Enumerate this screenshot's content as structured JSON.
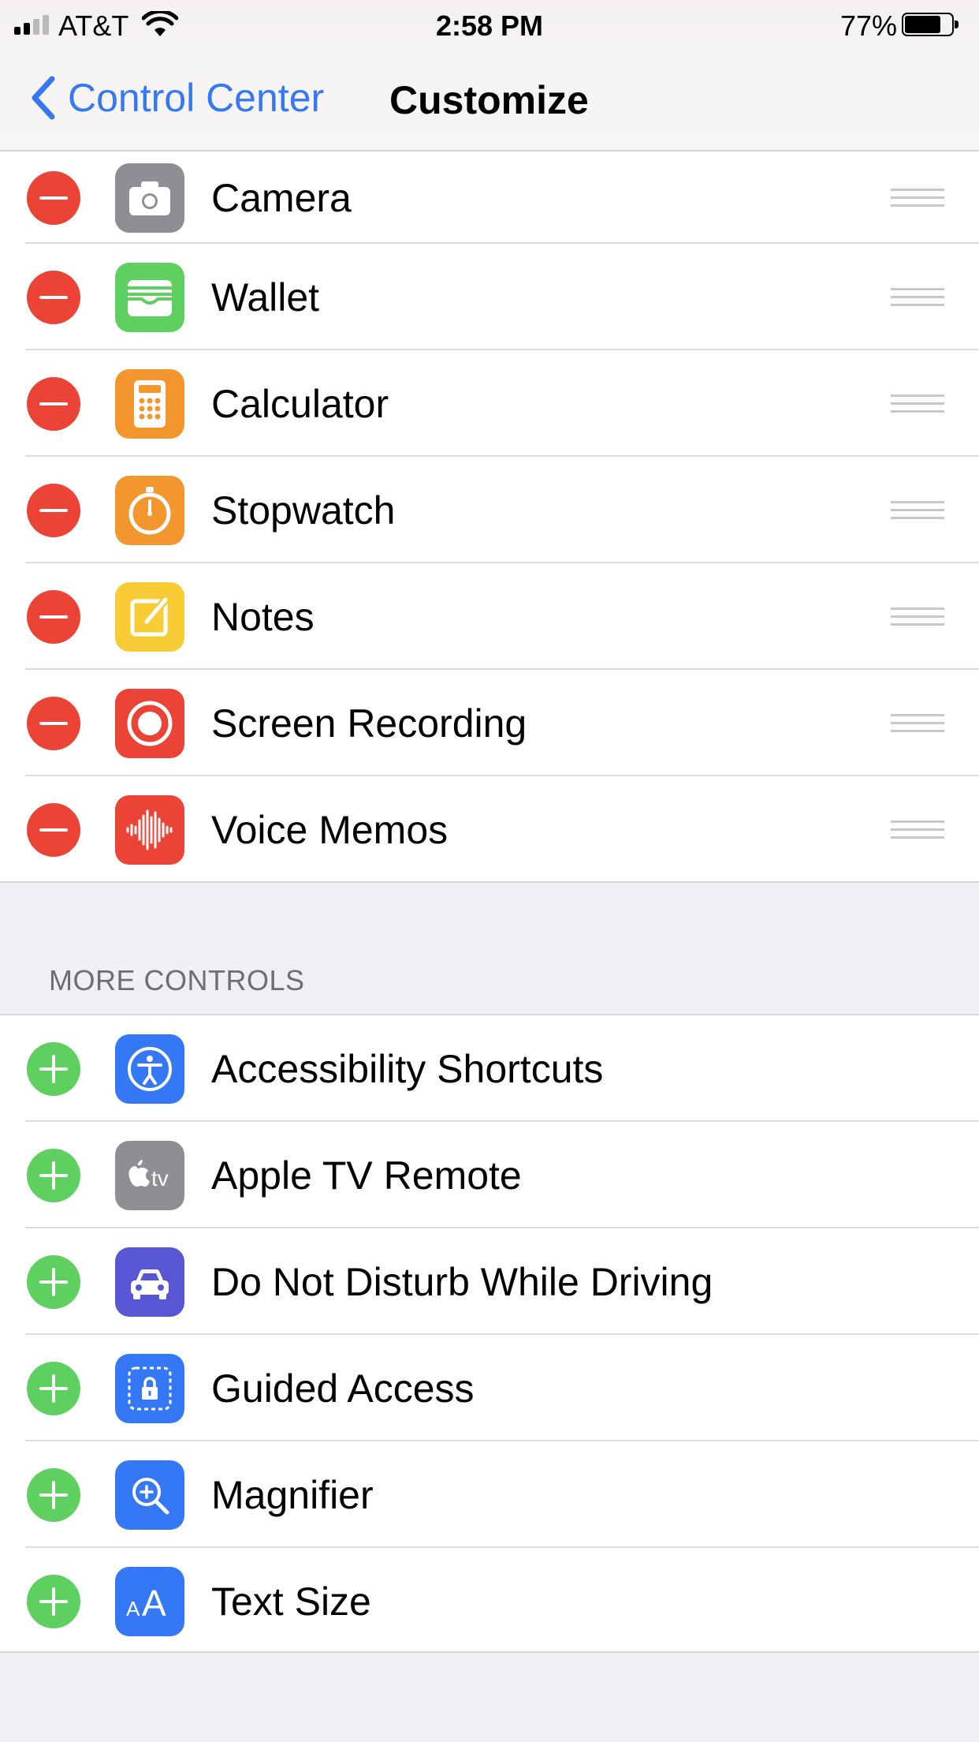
{
  "status_bar": {
    "carrier": "AT&T",
    "time": "2:58 PM",
    "battery_percent": "77%",
    "battery_level": 0.77,
    "signal_bars": 2,
    "icons": [
      "signal-icon",
      "wifi-icon",
      "battery-icon"
    ]
  },
  "nav": {
    "back_label": "Control Center",
    "title": "Customize",
    "back_icon": "chevron-left-icon"
  },
  "included": [
    {
      "label": "Camera",
      "icon": "camera-icon",
      "color": "#8e8e93"
    },
    {
      "label": "Wallet",
      "icon": "wallet-icon",
      "color": "#5ed060"
    },
    {
      "label": "Calculator",
      "icon": "calculator-icon",
      "color": "#f4962e"
    },
    {
      "label": "Stopwatch",
      "icon": "stopwatch-icon",
      "color": "#f4962e"
    },
    {
      "label": "Notes",
      "icon": "notes-icon",
      "color": "#f8cc34"
    },
    {
      "label": "Screen Recording",
      "icon": "screen-recording-icon",
      "color": "#eb4335"
    },
    {
      "label": "Voice Memos",
      "icon": "voice-memos-icon",
      "color": "#eb4335"
    }
  ],
  "more_controls": {
    "header": "MORE CONTROLS",
    "items": [
      {
        "label": "Accessibility Shortcuts",
        "icon": "accessibility-icon",
        "color": "#3478f6"
      },
      {
        "label": "Apple TV Remote",
        "icon": "apple-tv-icon",
        "color": "#8e8e93"
      },
      {
        "label": "Do Not Disturb While Driving",
        "icon": "car-icon",
        "color": "#5956d6"
      },
      {
        "label": "Guided Access",
        "icon": "guided-access-icon",
        "color": "#3478f6"
      },
      {
        "label": "Magnifier",
        "icon": "magnifier-icon",
        "color": "#3478f6"
      },
      {
        "label": "Text Size",
        "icon": "text-size-icon",
        "color": "#3478f6"
      }
    ]
  },
  "colors": {
    "accent": "#3478f6",
    "remove": "#eb4335",
    "add": "#5ed060",
    "background": "#efeff4"
  }
}
